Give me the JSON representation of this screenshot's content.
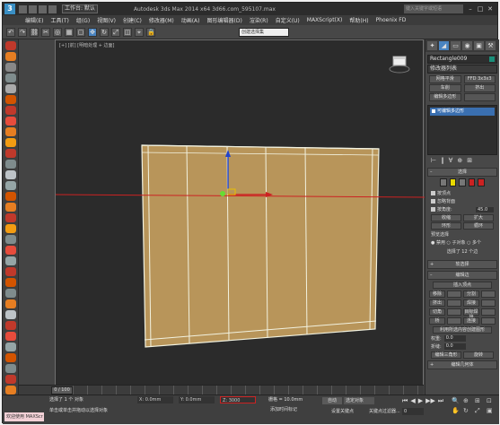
{
  "titlebar": {
    "logo": "3",
    "workspace": "工作台: 默认",
    "title": "Autodesk 3ds Max  2014 x64    3d66.com_595107.max",
    "search_placeholder": "键入关键字或短语",
    "min": "–",
    "max": "□",
    "close": "✕"
  },
  "menu": [
    "编辑(E)",
    "工具(T)",
    "组(G)",
    "视图(V)",
    "创建(C)",
    "修改器(M)",
    "动画(A)",
    "图形编辑器(D)",
    "渲染(R)",
    "自定义(U)",
    "MAXScript(X)",
    "帮助(H)",
    "Phoenix FD"
  ],
  "toolbar": {
    "icons": [
      "↶",
      "↷",
      "⛓",
      "✂",
      "◎",
      "▦",
      "▢",
      "✥",
      "↻",
      "⤢",
      "◫",
      "⌖",
      "🔒"
    ],
    "selset_placeholder": "创建选择集"
  },
  "left_icon_colors": [
    "#c0392b",
    "#e67e22",
    "#888",
    "#7f8c8d",
    "#aaa",
    "#d35400",
    "#c0392b",
    "#e74c3c",
    "#e67e22",
    "#f39c12",
    "#c0392b",
    "#7f8c8d",
    "#bdc3c7",
    "#95a5a6",
    "#d35400",
    "#e67e22",
    "#c0392b",
    "#f39c12",
    "#7f8c8d",
    "#e74c3c",
    "#95a5a6",
    "#c0392b",
    "#d35400",
    "#7f8c8d",
    "#e67e22",
    "#bdc3c7",
    "#c0392b",
    "#e74c3c",
    "#95a5a6",
    "#d35400",
    "#7f8c8d",
    "#c0392b",
    "#e67e22",
    "#4a84c0"
  ],
  "viewport": {
    "label": "[+] [前] [明暗处理 + 边面]",
    "object_color": "#b8955a",
    "edge_color": "#f2f2e0"
  },
  "panel": {
    "tabs": [
      "✦",
      "◢",
      "▭",
      "◉",
      "▣",
      "⚒"
    ],
    "object_name": "Rectangle009",
    "object_color": "#1a8f7a",
    "modifier_list": "修改器列表",
    "buttons": [
      "网格平滑",
      "FFD 3x3x3",
      "车削",
      "挤出",
      "编辑多边形",
      ""
    ],
    "stack_item": "可编辑多边形",
    "stack_icons": [
      "⊢",
      "‖",
      "∀",
      "⊕",
      "⊞"
    ],
    "selection": {
      "title": "选择",
      "checkboxes": [
        "按顶点",
        "忽略背面",
        "按角度:"
      ],
      "angle": "45.0",
      "btns": [
        "收缩",
        "扩大",
        "环形",
        "循环"
      ],
      "preview": "预览选择",
      "preview_opts": "● 禁用  ○ 子对象  ○ 多个",
      "status": "选择了 12 个边"
    },
    "soft_selection": "软选择",
    "edit_edges": {
      "title": "编辑边",
      "insert_vertex": "插入顶点",
      "btns": [
        "移除",
        "分割",
        "挤出",
        "焊接",
        "切角",
        "目标焊接",
        "桥",
        "连接"
      ],
      "create_shape": "利用所选内容创建图形",
      "weight_lbl": "权重:",
      "weight": "0.0",
      "crease_lbl": "折缝:",
      "crease": "0.0",
      "edit_tri": "编辑三角形",
      "turn": "旋转"
    },
    "edit_geometry": "编辑几何体"
  },
  "timeline": {
    "slider": "0 / 100"
  },
  "status": {
    "maxscript": "欢迎使用 MAXScr",
    "msg1": "选择了 1 个 对象",
    "msg2": "单击或单击并拖动以选择对象",
    "x": "X: 0.0mm",
    "y": "Y: 0.0mm",
    "z": "Z: 3000",
    "grid": "栅格 = 10.0mm",
    "addkey": "添加时间标记",
    "autokey": "自动",
    "selected": "选定对象",
    "setkey": "设置关键点",
    "keyfilter": "关键点过滤器...",
    "frame": "0",
    "play": [
      "⏮",
      "◀",
      "▶",
      "▶▶",
      "⏭"
    ],
    "nav": [
      "🔍",
      "⊕",
      "⊞",
      "⊡",
      "✋",
      "↻",
      "⤢",
      "▣"
    ]
  }
}
